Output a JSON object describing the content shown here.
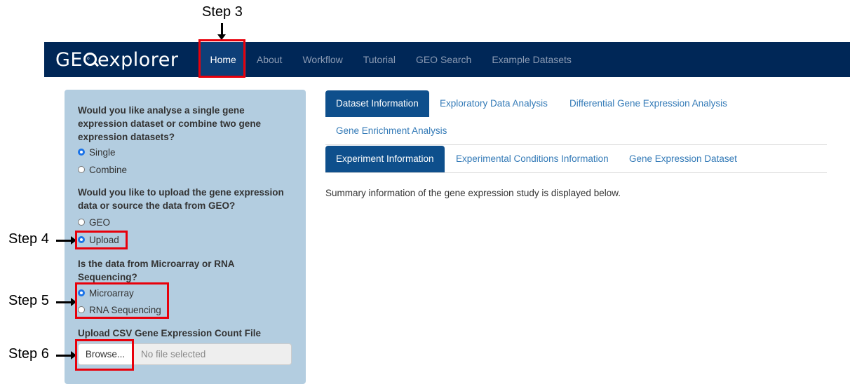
{
  "brand": {
    "pre": "GE",
    "mid": "o",
    "post": "explorer"
  },
  "nav": {
    "items": [
      {
        "label": "Home",
        "active": true
      },
      {
        "label": "About"
      },
      {
        "label": "Workflow"
      },
      {
        "label": "Tutorial"
      },
      {
        "label": "GEO Search"
      },
      {
        "label": "Example Datasets"
      }
    ]
  },
  "sidebar": {
    "q1": "Would you like analyse a single gene expression dataset or combine two gene expression datasets?",
    "q1_options": [
      "Single",
      "Combine"
    ],
    "q1_selected": "Single",
    "q2": "Would you like to upload the gene expression data or source the data from GEO?",
    "q2_options": [
      "GEO",
      "Upload"
    ],
    "q2_selected": "Upload",
    "q3": "Is the data from Microarray or RNA Sequencing?",
    "q3_options": [
      "Microarray",
      "RNA Sequencing"
    ],
    "q3_selected": "Microarray",
    "upload_label": "Upload CSV Gene Expression Count File",
    "browse_label": "Browse...",
    "file_placeholder": "No file selected"
  },
  "main": {
    "tabs": [
      {
        "label": "Dataset Information",
        "active": true
      },
      {
        "label": "Exploratory Data Analysis"
      },
      {
        "label": "Differential Gene Expression Analysis"
      },
      {
        "label": "Gene Enrichment Analysis"
      }
    ],
    "subtabs": [
      {
        "label": "Experiment Information",
        "active": true
      },
      {
        "label": "Experimental Conditions Information"
      },
      {
        "label": "Gene Expression Dataset"
      }
    ],
    "summary": "Summary information of the gene expression study is displayed below."
  },
  "annotations": {
    "step3": "Step 3",
    "step4": "Step 4",
    "step5": "Step 5",
    "step6": "Step 6",
    "highlight_color": "#e8000b"
  }
}
